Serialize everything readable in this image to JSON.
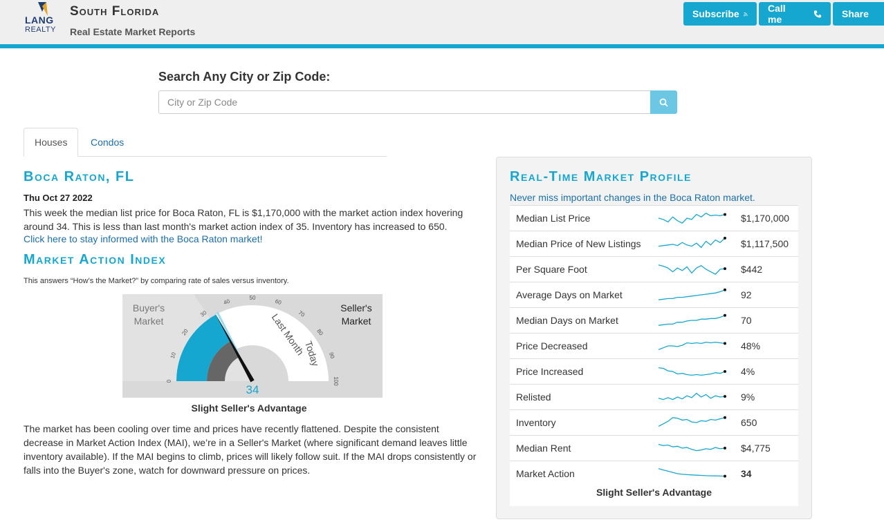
{
  "header": {
    "logo": {
      "lang": "LANG",
      "realty": "REALTY"
    },
    "title": "South Florida",
    "subtitle": "Real Estate Market Reports",
    "buttons": {
      "subscribe": "Subscribe",
      "call": "Call me",
      "share": "Share"
    }
  },
  "search": {
    "label": "Search Any City or Zip Code:",
    "placeholder": "City or Zip Code"
  },
  "tabs": [
    {
      "label": "Houses",
      "active": true
    },
    {
      "label": "Condos",
      "active": false
    }
  ],
  "report": {
    "city": "Boca Raton, FL",
    "date": "Thu Oct 27 2022",
    "summary": "This week the median list price for Boca Raton, FL is $1,170,000 with the market action index hovering around 34. This is less than last month's market action index of 35. Inventory has increased to 650.",
    "link": "Click here to stay informed with the Boca Raton market!"
  },
  "mai": {
    "title": "Market Action Index",
    "description": "This answers “How’s the Market?” by comparing rate of sales versus inventory.",
    "gauge": {
      "value": 34,
      "last_month": 35,
      "buyer_label_1": "Buyer's",
      "buyer_label_2": "Market",
      "seller_label_1": "Seller's",
      "seller_label_2": "Market",
      "last_month_label": "Last Month",
      "today_label": "Today",
      "ticks": [
        "0",
        "10",
        "20",
        "30",
        "40",
        "50",
        "60",
        "70",
        "80",
        "90",
        "100"
      ],
      "value_text": "34"
    },
    "caption": "Slight Seller's Advantage",
    "paragraph": "The market has been cooling over time and prices have recently flattened. Despite the consistent decrease in Market Action Index (MAI), we’re in a Seller's Market (where significant demand leaves little inventory available). If the MAI begins to climb, prices will likely follow suit. If the MAI drops consistently or falls into the Buyer's zone, watch for downward pressure on prices."
  },
  "profile": {
    "title": "Real-Time Market Profile",
    "subtitle": "Never miss important changes in the Boca Raton market.",
    "rows": [
      {
        "label": "Median List Price",
        "value": "$1,170,000",
        "trend": [
          0.5,
          0.4,
          0.2,
          0.6,
          0.3,
          0.1,
          0.5,
          0.4,
          0.8,
          0.6,
          0.9,
          0.7,
          0.75,
          0.7,
          0.8
        ]
      },
      {
        "label": "Median Price of New Listings",
        "value": "$1,117,500",
        "trend": [
          0.3,
          0.35,
          0.4,
          0.45,
          0.35,
          0.6,
          0.4,
          0.3,
          0.55,
          0.2,
          0.7,
          0.4,
          0.8,
          0.6,
          0.95
        ]
      },
      {
        "label": "Per Square Foot",
        "value": "$442",
        "trend": [
          0.85,
          0.75,
          0.6,
          0.3,
          0.6,
          0.4,
          0.7,
          0.2,
          0.6,
          0.8,
          0.5,
          0.3,
          0.1,
          0.5,
          0.55
        ]
      },
      {
        "label": "Average Days on Market",
        "value": "92",
        "trend": [
          0.1,
          0.15,
          0.2,
          0.2,
          0.3,
          0.3,
          0.35,
          0.4,
          0.45,
          0.5,
          0.55,
          0.6,
          0.65,
          0.75,
          0.9
        ]
      },
      {
        "label": "Median Days on Market",
        "value": "70",
        "trend": [
          0.1,
          0.15,
          0.2,
          0.2,
          0.35,
          0.35,
          0.45,
          0.5,
          0.5,
          0.6,
          0.6,
          0.65,
          0.65,
          0.75,
          0.9
        ]
      },
      {
        "label": "Price Decreased",
        "value": "48%",
        "trend": [
          0.2,
          0.35,
          0.5,
          0.5,
          0.45,
          0.55,
          0.75,
          0.7,
          0.75,
          0.7,
          0.8,
          0.75,
          0.8,
          0.75,
          0.7
        ]
      },
      {
        "label": "Price Increased",
        "value": "4%",
        "trend": [
          0.8,
          0.75,
          0.55,
          0.5,
          0.3,
          0.35,
          0.25,
          0.2,
          0.25,
          0.2,
          0.25,
          0.3,
          0.4,
          0.35,
          0.5
        ]
      },
      {
        "label": "Relisted",
        "value": "9%",
        "trend": [
          0.4,
          0.3,
          0.45,
          0.3,
          0.5,
          0.35,
          0.6,
          0.45,
          0.8,
          0.5,
          0.7,
          0.4,
          0.6,
          0.5,
          0.55
        ]
      },
      {
        "label": "Inventory",
        "value": "650",
        "trend": [
          0.2,
          0.4,
          0.6,
          0.9,
          0.85,
          0.7,
          0.75,
          0.55,
          0.5,
          0.65,
          0.6,
          0.75,
          0.7,
          0.8,
          0.9
        ]
      },
      {
        "label": "Median Rent",
        "value": "$4,775",
        "trend": [
          0.8,
          0.7,
          0.75,
          0.6,
          0.65,
          0.5,
          0.55,
          0.4,
          0.3,
          0.35,
          0.45,
          0.4,
          0.55,
          0.45,
          0.5
        ]
      },
      {
        "label": "Market Action",
        "value": "34",
        "trend": [
          0.9,
          0.8,
          0.7,
          0.6,
          0.5,
          0.45,
          0.42,
          0.4,
          0.38,
          0.36,
          0.34,
          0.33,
          0.32,
          0.31,
          0.3
        ]
      }
    ],
    "footer": "Slight Seller's Advantage"
  },
  "colors": {
    "accent": "#15a7cf",
    "link": "#1a6fa8",
    "gauge_dark": "#666666"
  }
}
